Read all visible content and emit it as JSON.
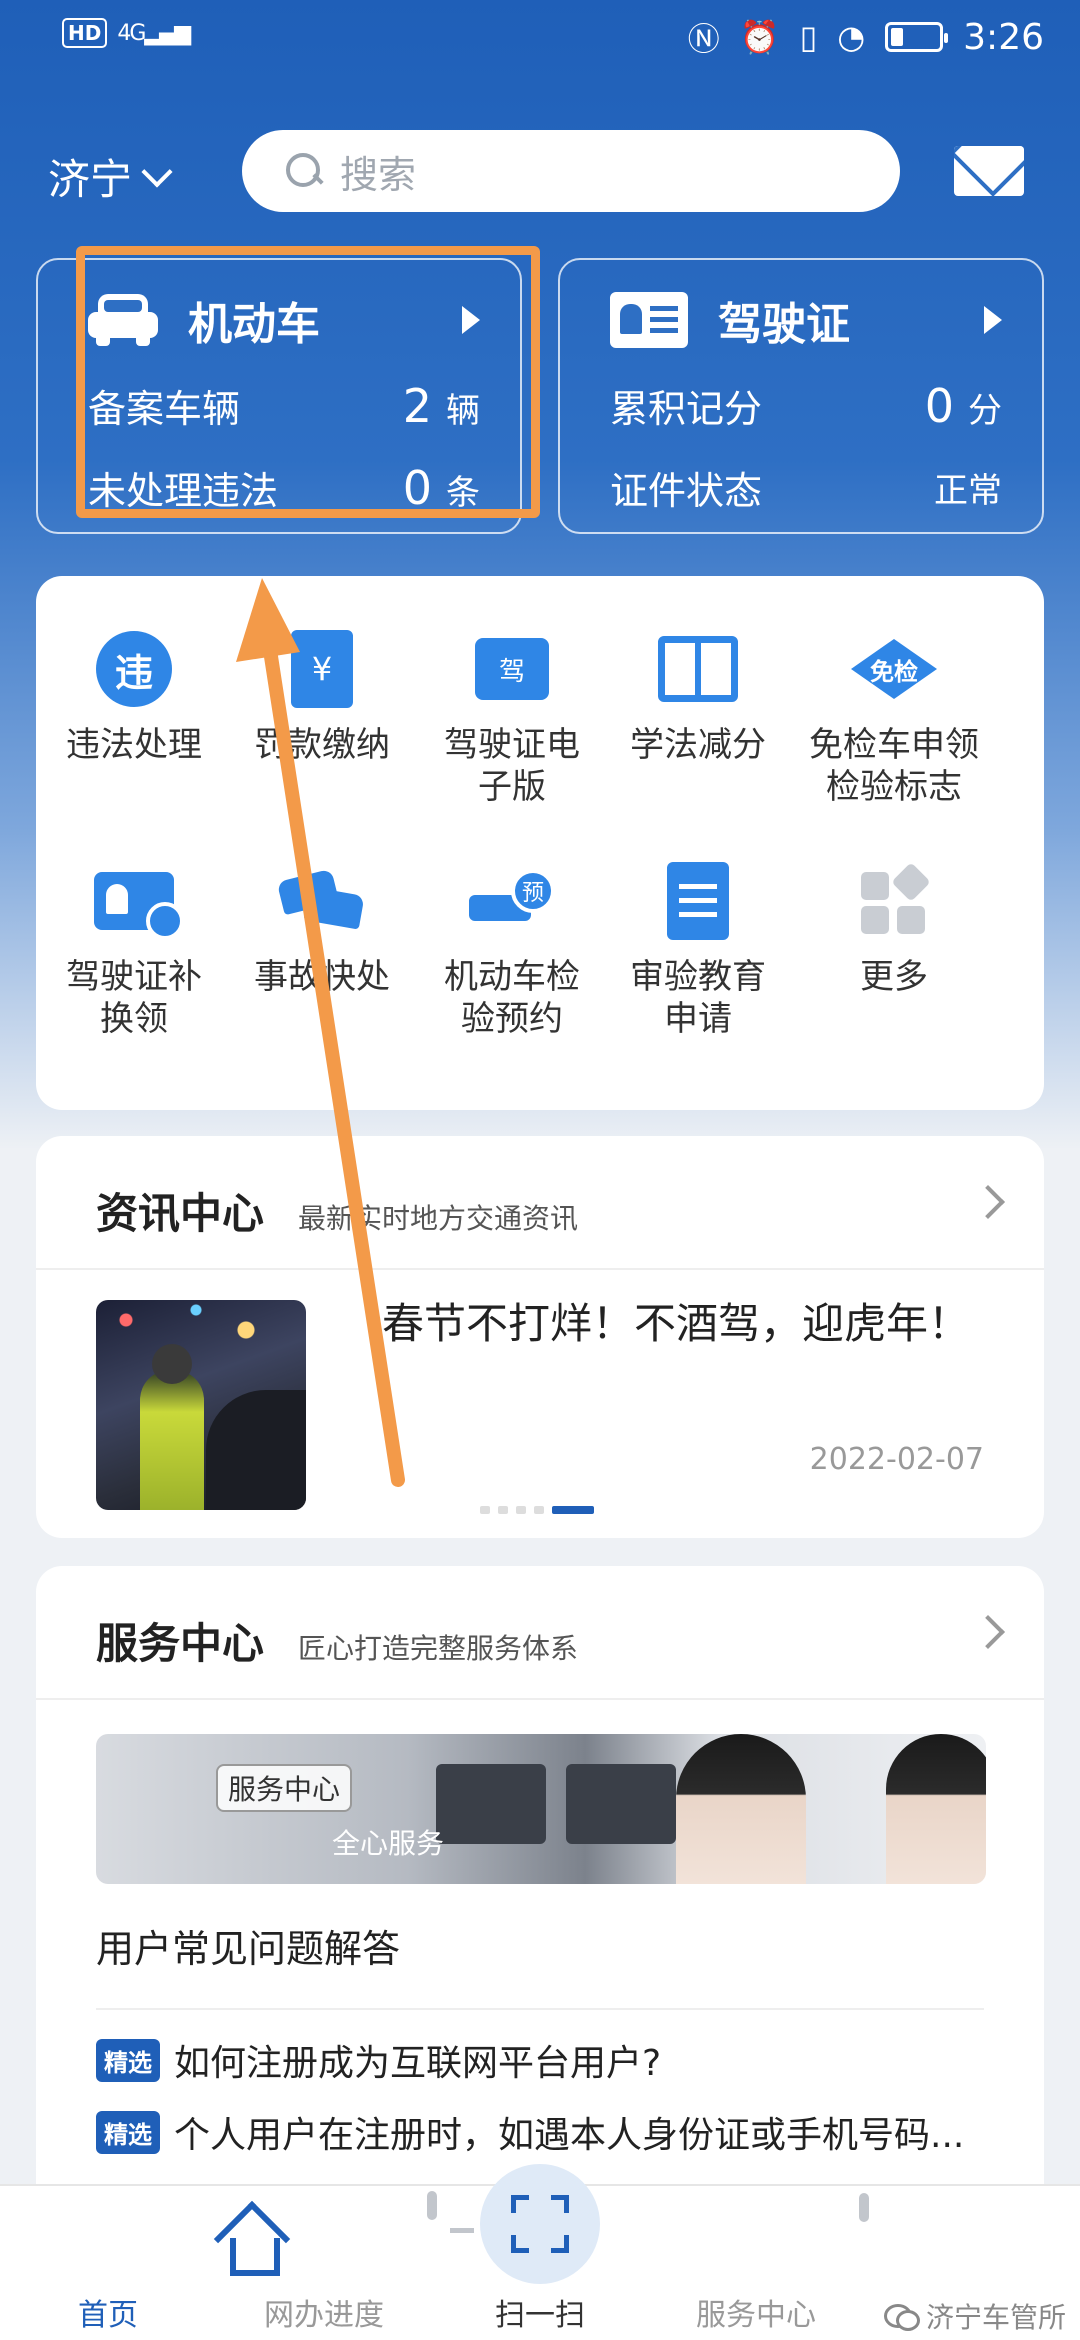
{
  "status_bar": {
    "hd_badge": "HD",
    "network": "4G",
    "time": "3:26",
    "icons": [
      "nfc-icon",
      "alarm-icon",
      "vibrate-icon",
      "speed-icon",
      "battery-icon"
    ]
  },
  "header": {
    "city": "济宁",
    "search_placeholder": "搜索"
  },
  "cards": {
    "vehicle": {
      "title": "机动车",
      "row1_label": "备案车辆",
      "row1_value": "2",
      "row1_unit": "辆",
      "row2_label": "未处理违法",
      "row2_value": "0",
      "row2_unit": "条"
    },
    "license": {
      "title": "驾驶证",
      "row1_label": "累积记分",
      "row1_value": "0",
      "row1_unit": "分",
      "row2_label": "证件状态",
      "row2_value": "正常"
    }
  },
  "services": [
    {
      "label": "违法处理",
      "glyph": "违"
    },
    {
      "label": "罚款缴纳",
      "glyph": "¥"
    },
    {
      "label": "驾驶证电子版",
      "glyph": "驾"
    },
    {
      "label": "学法减分"
    },
    {
      "label": "免检车申领检验标志",
      "glyph": "免检"
    },
    {
      "label": "驾驶证补换领"
    },
    {
      "label": "事故快处"
    },
    {
      "label": "机动车检验预约",
      "glyph": "预"
    },
    {
      "label": "审验教育申请"
    },
    {
      "label": "更多"
    }
  ],
  "news": {
    "title": "资讯中心",
    "subtitle": "最新实时地方交通资讯",
    "item_title": "春节不打烊！不酒驾，迎虎年！",
    "item_date": "2022-02-07"
  },
  "service_center": {
    "title": "服务中心",
    "subtitle": "匠心打造完整服务体系",
    "banner_tag": "服务中心",
    "banner_text": "全心服务",
    "faq_title": "用户常见问题解答",
    "faq": [
      {
        "badge": "精选",
        "text": "如何注册成为互联网平台用户?"
      },
      {
        "badge": "精选",
        "text": "个人用户在注册时，如遇本人身份证或手机号码..."
      }
    ]
  },
  "bottom_nav": [
    {
      "label": "首页",
      "active": true
    },
    {
      "label": "网办进度"
    },
    {
      "label": "扫一扫"
    },
    {
      "label": "服务中心"
    },
    {
      "label": ""
    }
  ],
  "watermark": "济宁车管所",
  "colors": {
    "primary": "#1f5fb8",
    "icon_blue": "#2f86e6",
    "annotation_orange": "#f39a49"
  }
}
